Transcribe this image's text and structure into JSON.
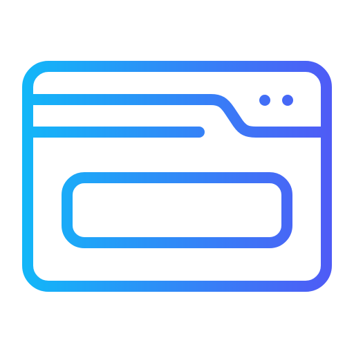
{
  "icon": {
    "name": "browser-window-tab-icon",
    "colors": {
      "gradient_start": "#12b7f8",
      "gradient_end": "#4f5bf6",
      "background": "#ffffff"
    }
  }
}
